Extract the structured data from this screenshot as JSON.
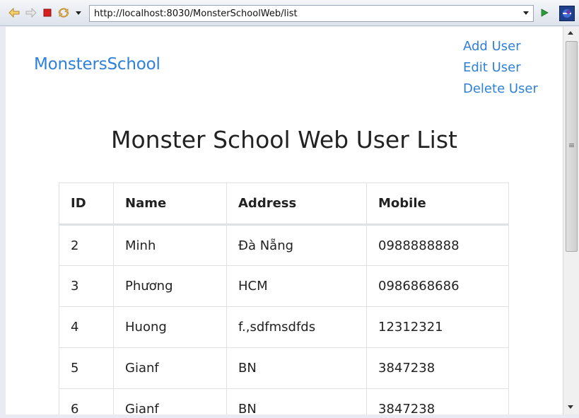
{
  "browser": {
    "url": "http://localhost:8030/MonsterSchoolWeb/list",
    "icons": [
      "back-icon",
      "forward-icon",
      "stop-icon",
      "refresh-icon",
      "dropdown-icon",
      "go-icon",
      "eclipse-icon"
    ],
    "colors": {
      "toolbar": "#dde3ec",
      "go": "#2a9d3a",
      "stop": "#d62020"
    }
  },
  "header": {
    "brand": "MonstersSchool",
    "nav": [
      "Add User",
      "Edit User",
      "Delete User"
    ]
  },
  "main": {
    "title": "Monster School Web User List",
    "table": {
      "columns": [
        "ID",
        "Name",
        "Address",
        "Mobile"
      ],
      "rows": [
        [
          "2",
          "Minh",
          "Đà Nẵng",
          "0988888888"
        ],
        [
          "3",
          "Phương",
          "HCM",
          "0986868686"
        ],
        [
          "4",
          "Huong",
          "f.,sdfmsdfds",
          "12312321"
        ],
        [
          "5",
          "Gianf",
          "BN",
          "3847238"
        ],
        [
          "6",
          "Gianf",
          "BN",
          "3847238"
        ]
      ]
    }
  },
  "theme": {
    "link": "#2f80d8",
    "text": "#222222",
    "border": "#dee2e6"
  }
}
